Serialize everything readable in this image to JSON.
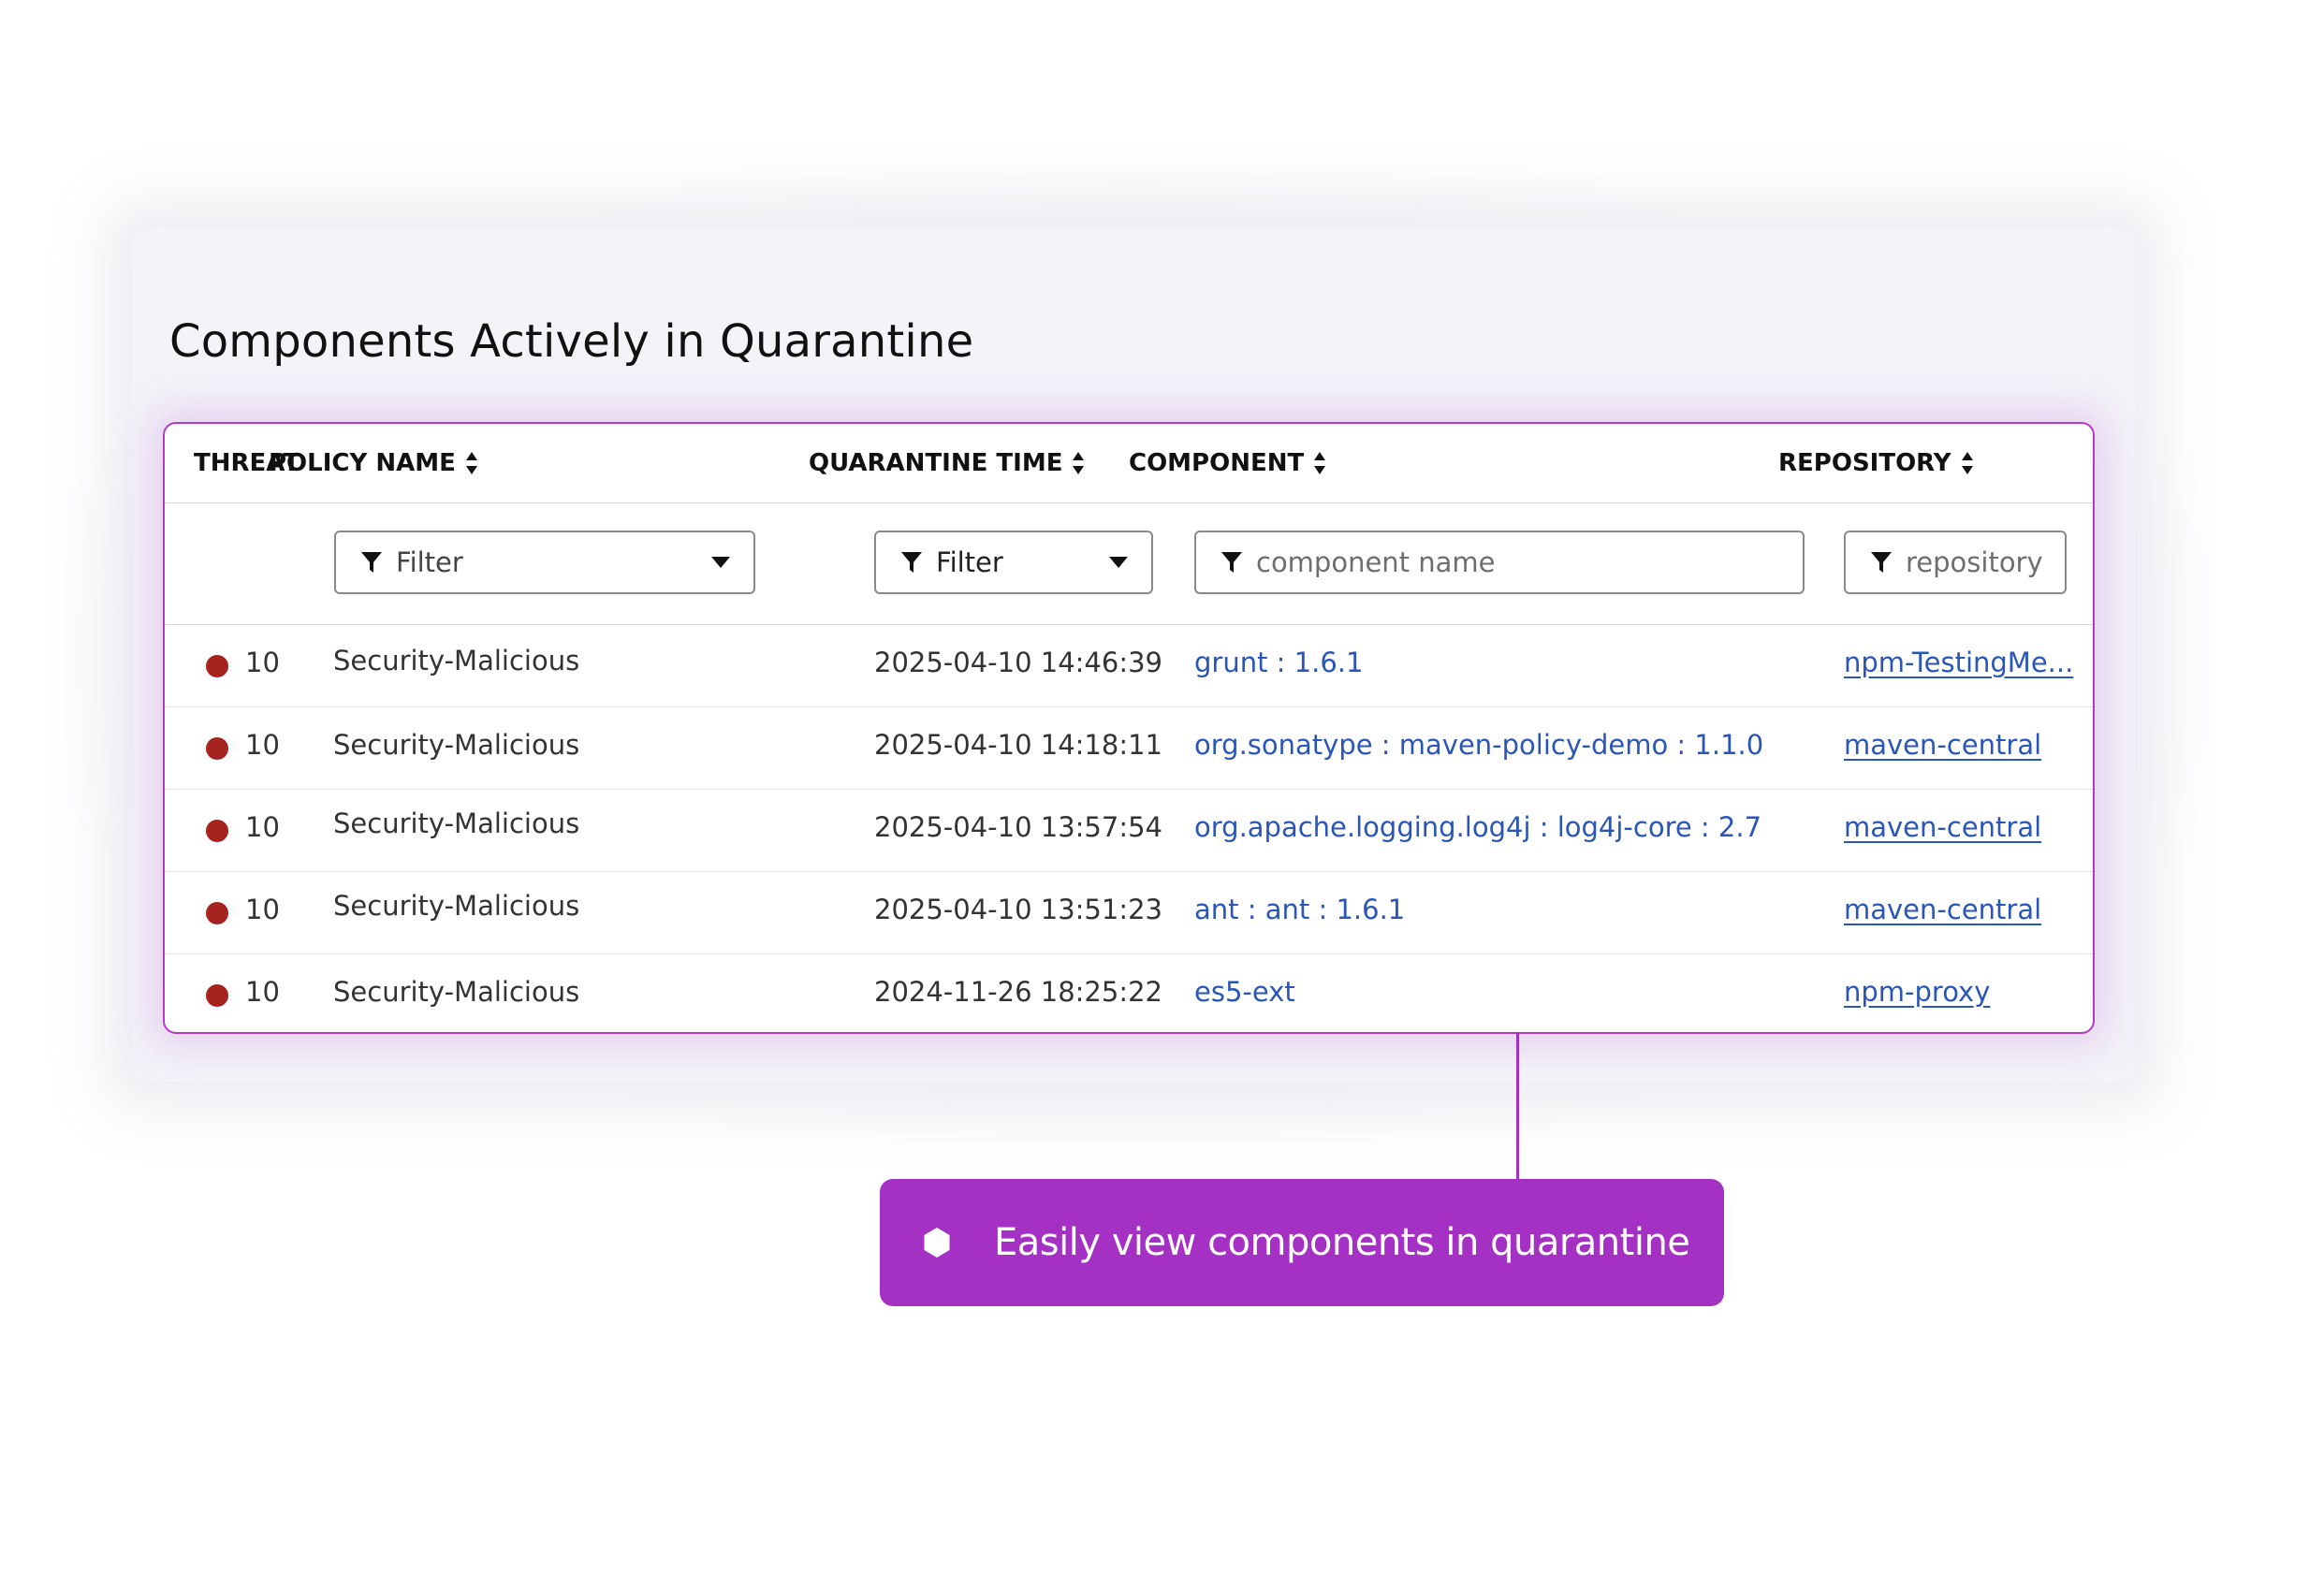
{
  "title": "Components Actively in Quarantine",
  "accent_color": "#a531c4",
  "threat_color": "#a6231f",
  "link_color": "#2a56b8",
  "columns": {
    "threat": "THREAT",
    "policy_name": "POLICY NAME",
    "quarantine_time": "QUARANTINE TIME",
    "component": "COMPONENT",
    "repository": "REPOSITORY"
  },
  "filters": {
    "policy_name": "Filter",
    "quarantine_time": "Filter",
    "component_placeholder": "component name",
    "repository_placeholder": "repository"
  },
  "rows": [
    {
      "threat": "10",
      "policy": "Security-Malicious",
      "time": "2025-04-10 14:46:39",
      "component": "grunt : 1.6.1",
      "repository": "npm-TestingMe..."
    },
    {
      "threat": "10",
      "policy": "Security-Malicious",
      "time": "2025-04-10 14:18:11",
      "component": "org.sonatype : maven-policy-demo : 1.1.0",
      "repository": "maven-central"
    },
    {
      "threat": "10",
      "policy": "Security-Malicious",
      "time": "2025-04-10 13:57:54",
      "component": "org.apache.logging.log4j : log4j-core : 2.7",
      "repository": "maven-central"
    },
    {
      "threat": "10",
      "policy": "Security-Malicious",
      "time": "2025-04-10 13:51:23",
      "component": "ant : ant : 1.6.1",
      "repository": "maven-central"
    },
    {
      "threat": "10",
      "policy": "Security-Malicious",
      "time": "2024-11-26 18:25:22",
      "component": "es5-ext",
      "repository": "npm-proxy"
    }
  ],
  "callout": {
    "text": "Easily view components in quarantine",
    "icon": "hexagon-icon"
  },
  "icons": {
    "sort": "sort-icon",
    "filter": "filter-icon",
    "dropdown": "caret-down-icon",
    "threat_level": "threat-dot-icon"
  }
}
